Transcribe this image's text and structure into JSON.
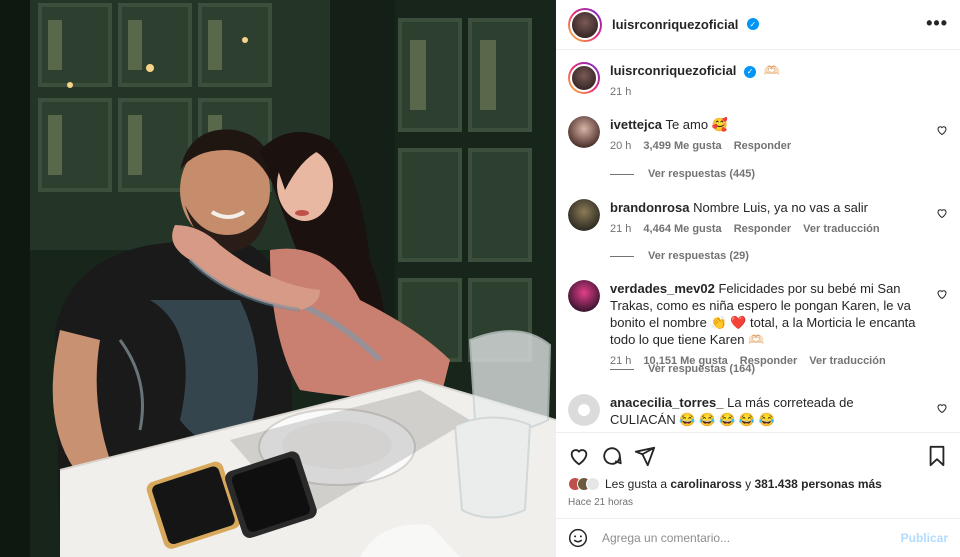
{
  "post": {
    "username": "luisrconriquezoficial",
    "verified": true,
    "more_icon": "more-horizontal-icon"
  },
  "caption": {
    "username": "luisrconriquezoficial",
    "text": "🫶🏻",
    "time": "21 h"
  },
  "comments": [
    {
      "username": "ivettejca",
      "text": "Te amo 🥰",
      "time": "20 h",
      "likes": "3,499 Me gusta",
      "reply": "Responder",
      "translate": "",
      "view_replies": "Ver respuestas (445)",
      "avatar_colors": [
        "#d8b4a6",
        "#4b2e2a"
      ]
    },
    {
      "username": "brandonrosa",
      "text": "Nombre Luis, ya no vas a salir",
      "time": "21 h",
      "likes": "4,464 Me gusta",
      "reply": "Responder",
      "translate": "Ver traducción",
      "view_replies": "Ver respuestas (29)",
      "avatar_colors": [
        "#6b5a3e",
        "#2c2a22"
      ]
    },
    {
      "username": "verdades_mev02",
      "text": "Felicidades por su bebé mi San Trakas, como es niña espero le pongan Karen, le va bonito el nombre 👏 ❤️ total, a la Morticia le encanta todo lo que tiene Karen 🫶🏻",
      "time": "21 h",
      "likes": "10,151 Me gusta",
      "reply": "Responder",
      "translate": "Ver traducción",
      "view_replies": "Ver respuestas (164)",
      "avatar_colors": [
        "#e23f8a",
        "#3a1430"
      ]
    },
    {
      "username": "anacecilia_torres_",
      "text": "La más correteada de CULIACÁN 😂 😂 😂 😂 😂",
      "time": "",
      "likes": "",
      "reply": "",
      "translate": "",
      "view_replies": "",
      "avatar_colors": [
        "#dbdbdb",
        "#c7c7c7"
      ]
    }
  ],
  "actions": {
    "like_icon": "heart-icon",
    "comment_icon": "comment-icon",
    "share_icon": "share-icon",
    "save_icon": "bookmark-icon"
  },
  "likes": {
    "prefix": "Les gusta a ",
    "user": "carolinaross",
    "middle": " y ",
    "count": "381.438 personas más"
  },
  "posted": "Hace 21 horas",
  "add_comment": {
    "placeholder": "Agrega un comentario...",
    "post_label": "Publicar",
    "emoji_icon": "emoji-icon"
  },
  "colors": {
    "verified": "#0095f6",
    "muted": "#737373",
    "post_disabled": "#b3dbff"
  }
}
